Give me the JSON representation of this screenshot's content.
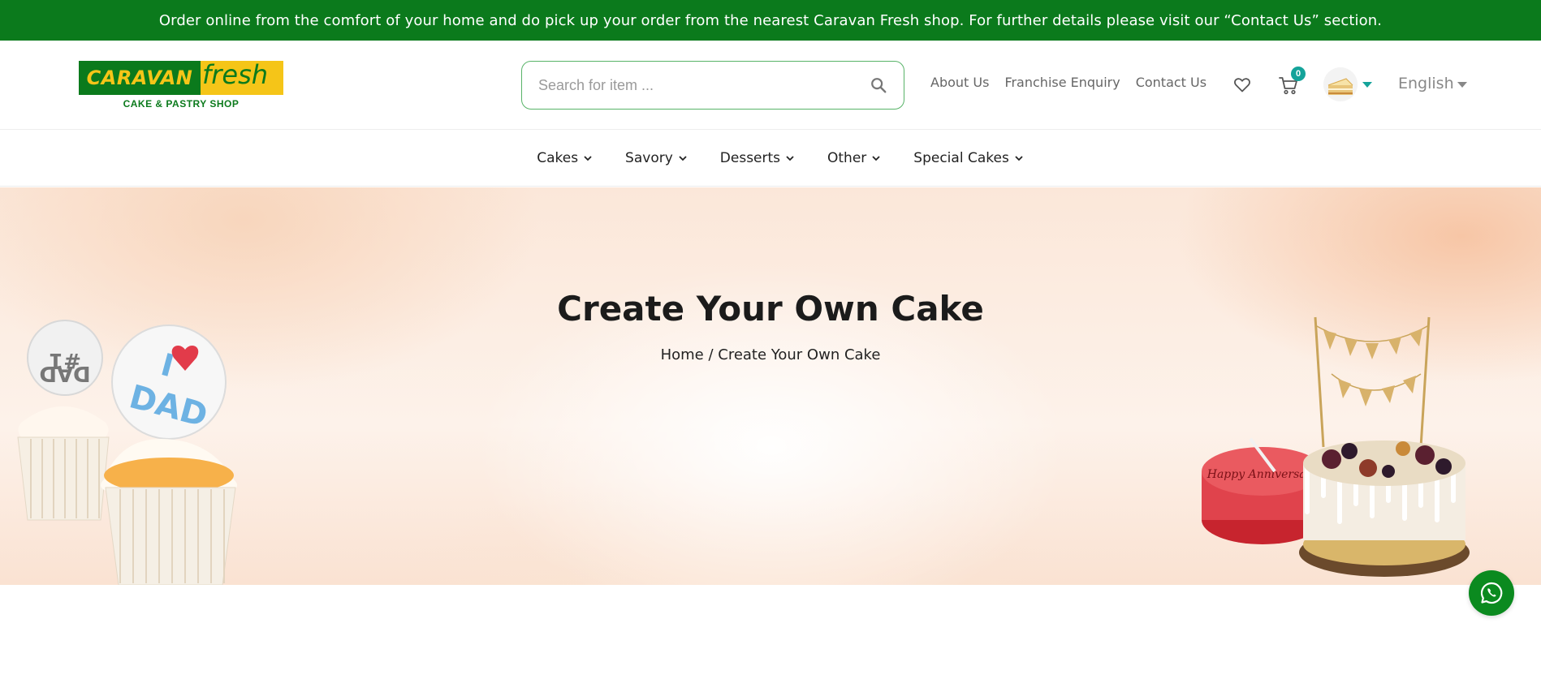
{
  "topbar": {
    "message": "Order online from the comfort of your home and do pick up your order from the nearest Caravan Fresh shop. For further details please visit our “Contact Us” section."
  },
  "logo": {
    "caravan": "CARAVAN",
    "fresh": "fresh",
    "tagline": "CAKE & PASTRY SHOP"
  },
  "search": {
    "placeholder": "Search for item ...",
    "value": ""
  },
  "header_links": [
    "About Us",
    "Franchise Enquiry",
    "Contact Us"
  ],
  "cart": {
    "count": "0"
  },
  "language": {
    "selected": "English"
  },
  "nav": {
    "items": [
      "Cakes",
      "Savory",
      "Desserts",
      "Other",
      "Special Cakes"
    ]
  },
  "hero": {
    "title": "Create Your Own Cake",
    "breadcrumb_home": "Home",
    "breadcrumb_sep": " / ",
    "breadcrumb_current": "Create Your Own Cake"
  },
  "colors": {
    "brand_green": "#0b7a1c",
    "brand_yellow": "#f5c518",
    "accent_teal": "#14a39a",
    "whatsapp_green": "#0b8a1f"
  }
}
